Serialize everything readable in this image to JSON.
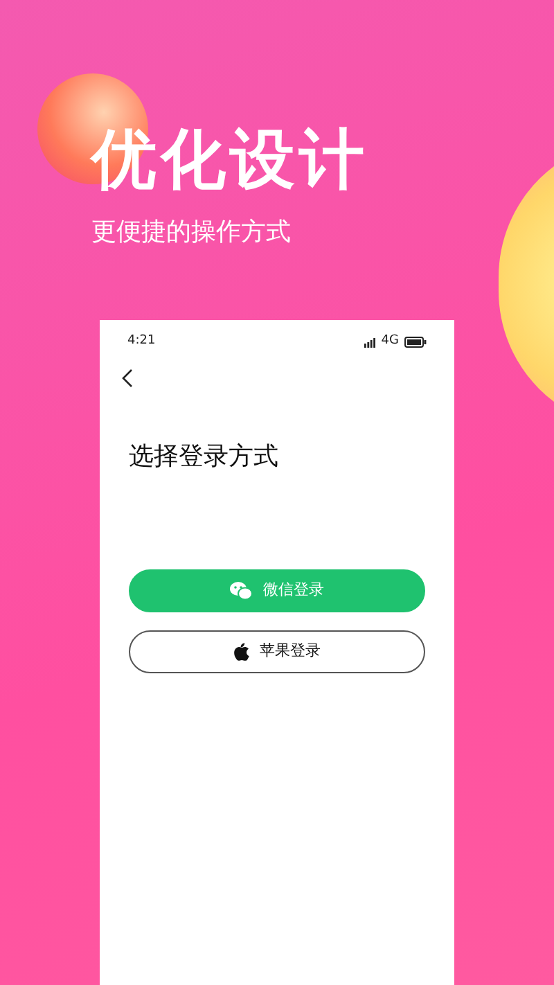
{
  "headline": "优化设计",
  "subheadline": "更便捷的操作方式",
  "phone": {
    "status_bar": {
      "time": "4:21",
      "network": "4G"
    },
    "title": "选择登录方式",
    "buttons": [
      {
        "kind": "wechat",
        "label": "微信登录"
      },
      {
        "kind": "apple",
        "label": "苹果登录"
      }
    ]
  }
}
